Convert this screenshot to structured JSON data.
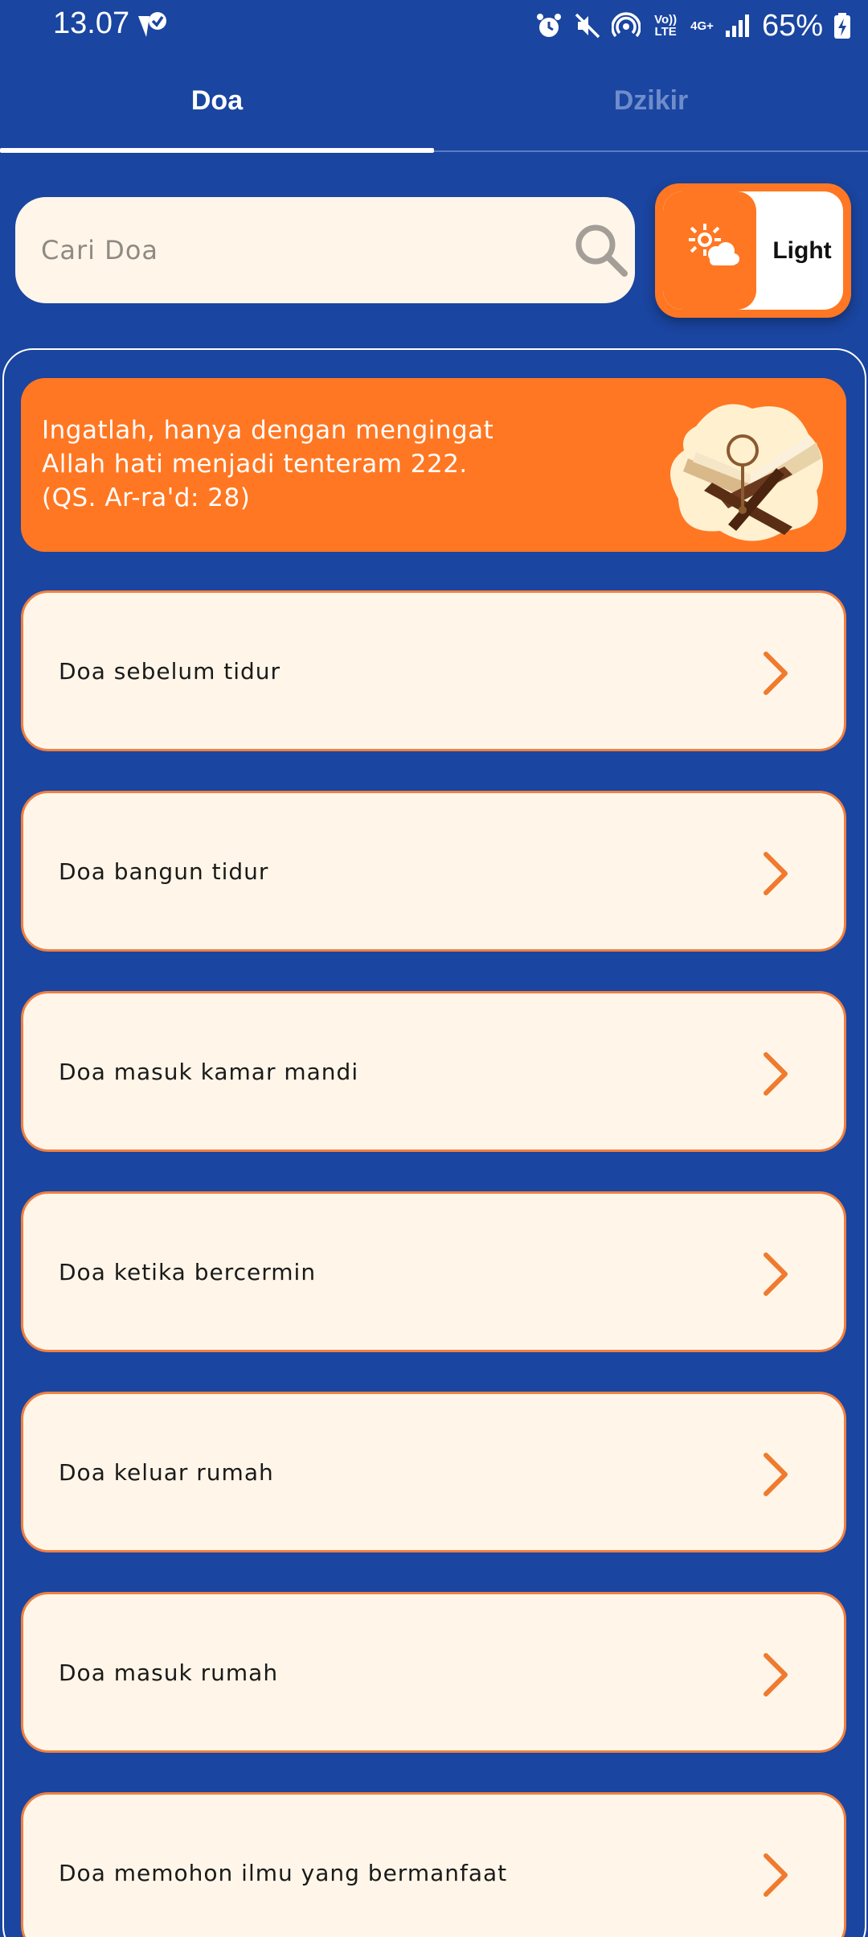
{
  "status_bar": {
    "time": "13.07",
    "volte": "Vo)) LTE",
    "network": "4G+",
    "battery": "65%"
  },
  "tabs": [
    {
      "label": "Doa",
      "active": true
    },
    {
      "label": "Dzikir",
      "active": false
    }
  ],
  "search": {
    "placeholder": "Cari Doa",
    "value": ""
  },
  "theme_toggle": {
    "label": "Light"
  },
  "banner": {
    "text": "Ingatlah, hanya dengan mengingat Allah hati menjadi tenteram 222. (QS. Ar-ra'd: 28)",
    "image_icon": "quran-rehal-illustration"
  },
  "doa_list": [
    {
      "label": "Doa sebelum tidur"
    },
    {
      "label": "Doa bangun tidur"
    },
    {
      "label": "Doa masuk kamar mandi"
    },
    {
      "label": "Doa ketika bercermin"
    },
    {
      "label": "Doa keluar rumah"
    },
    {
      "label": "Doa masuk rumah"
    },
    {
      "label": "Doa memohon ilmu yang bermanfaat"
    }
  ],
  "colors": {
    "background": "#1A45A0",
    "accent": "#FF7722",
    "card": "#FFF6E9",
    "card_border": "#F08040",
    "chevron": "#F07A2E"
  }
}
